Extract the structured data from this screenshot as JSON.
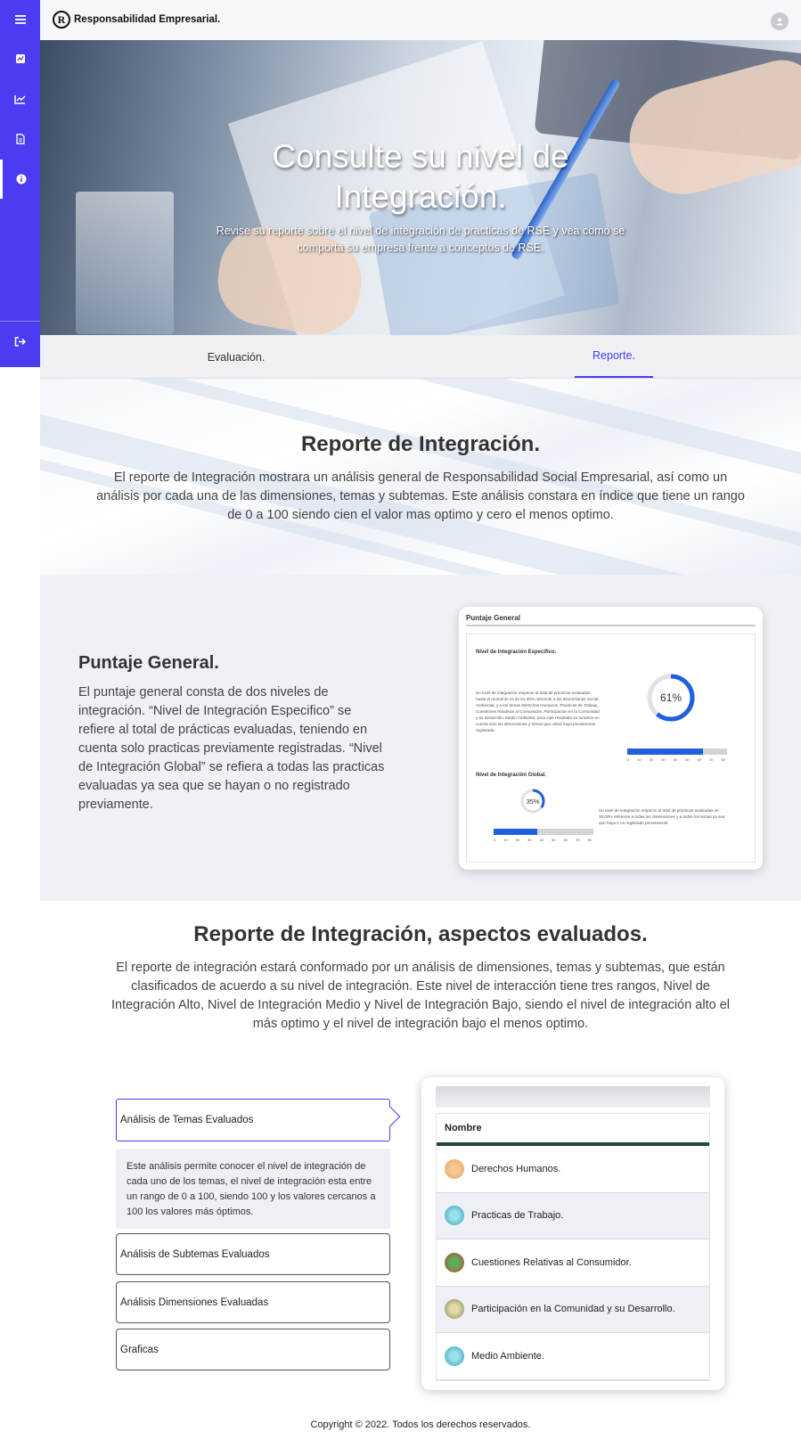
{
  "brand": {
    "name": "Responsabilidad Empresarial.",
    "logo_letter": "R"
  },
  "sidebar": {
    "items": [
      {
        "icon": "menu-icon"
      },
      {
        "icon": "presentation-icon"
      },
      {
        "icon": "line-chart-icon"
      },
      {
        "icon": "document-icon"
      },
      {
        "icon": "info-icon"
      },
      {
        "icon": "logout-icon"
      }
    ]
  },
  "hero": {
    "title_line1": "Consulte su nivel de",
    "title_line2": "Integración.",
    "subtitle": "Revise su reporte sobre el nivel de integración de practicas de RSE y vea como se comporta su empresa frente a conceptos de RSE."
  },
  "tabs": [
    {
      "label": "Evaluación."
    },
    {
      "label": "Reporte."
    }
  ],
  "reporte": {
    "title": "Reporte de Integración.",
    "text": "El reporte de Integración mostrara un análisis general de Responsabilidad Social Empresarial, así como un análisis por cada una de las dimensiones, temas y subtemas. Este análisis constara en índice que tiene un rango de 0 a 100 siendo cien el valor mas optimo y cero el menos optimo."
  },
  "puntaje": {
    "title": "Puntaje General.",
    "text": "El puntaje general consta de dos niveles de integración. “Nivel de Integración Especifico” se refiere al total de prácticas evaluadas, teniendo en cuenta solo practicas previamente registradas. “Nivel de Integración Global” se refiera a todas las practicas evaluadas ya sea que se hayan o no registrado previamente.",
    "card": {
      "header": "Puntaje General",
      "specific_label": "Nivel de Integración Especifico.",
      "specific_text": "Su nivel de integración respecto al total de prácticas evaluadas hasta el momento es de 61.00% referente a las dimensiones Social, Ambiental, y a los temas Derechos Humanos, Practicas de Trabajo, Cuestiones Relativas al Consumidor, Participación en la Comunidad y su Desarrollo, Medio Ambiente, para este resultado se tomaron en cuenta solo las dimensiones y temas que usted haya previamente registrado.",
      "specific_value": "61%",
      "specific_pct": 61,
      "global_label": "Nivel de Integración Global.",
      "global_text": "Su nivel de integración respecto al total de prácticas evaluadas es 35.00% referente a todas las dimensiones y a todos los temas ya sea que haya o no registrado previamente.",
      "global_value": "35%",
      "global_pct": 35,
      "ticks_a": [
        "0",
        "10",
        "20",
        "30",
        "40",
        "50",
        "60",
        "70",
        "80"
      ],
      "ticks_b": [
        "0",
        "10",
        "20",
        "30",
        "40",
        "50",
        "60",
        "70",
        "80"
      ]
    }
  },
  "aspectos": {
    "title": "Reporte de Integración, aspectos evaluados.",
    "text": "El reporte de integración estará conformado por un análisis de dimensiones, temas y subtemas, que están clasificados de acuerdo a su nivel de integración. Este nivel de interacción tiene tres rangos, Nivel de Integración Alto, Nivel de Integración Medio y Nivel de Integración Bajo, siendo el nivel de integración alto el más optimo y el nivel de integración bajo el menos optimo.",
    "accordion": [
      {
        "label": "Análisis de Temas Evaluados"
      },
      {
        "label": "Análisis de Subtemas Evaluados"
      },
      {
        "label": "Análisis Dimensiones Evaluadas"
      },
      {
        "label": "Graficas"
      }
    ],
    "accordion_desc": "Este análisis permite conocer el nivel de integración de cada uno de los temas, el nivel de integración esta entre un rango de 0 a 100, siendo 100 y los valores cercanos a 100 los valores más óptimos.",
    "table": {
      "header": "Nombre",
      "rows": [
        {
          "name": "Derechos Humanos.",
          "icon": "human-rights-icon",
          "color": "#e8a15c"
        },
        {
          "name": "Practicas de Trabajo.",
          "icon": "work-practices-icon",
          "color": "#2f9db1"
        },
        {
          "name": "Cuestiones Relativas al Consumidor.",
          "icon": "consumer-icon",
          "color": "#c93b2e"
        },
        {
          "name": "Participación en la Comunidad y su Desarrollo.",
          "icon": "community-icon",
          "color": "#7a8a5a"
        },
        {
          "name": "Medio Ambiente.",
          "icon": "environment-icon",
          "color": "#2f9db1"
        }
      ]
    }
  },
  "footer": {
    "text": "Copyright © 2022. Todos los derechos reservados."
  },
  "colors": {
    "accent": "#4b3cf2",
    "bar": "#1f5fe0",
    "table_rule": "#1f4a36"
  }
}
